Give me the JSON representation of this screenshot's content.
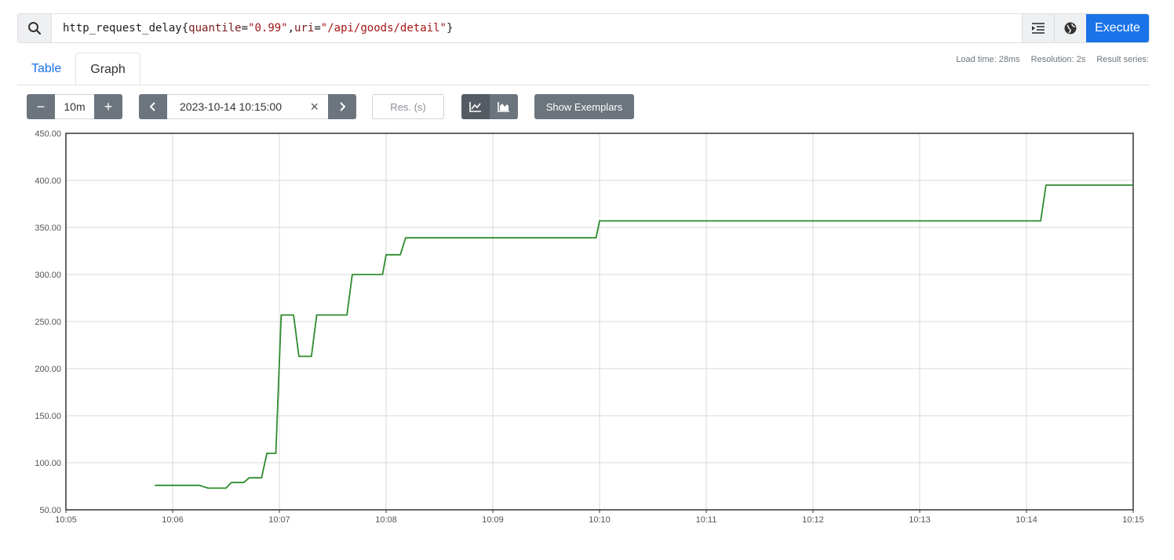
{
  "query": {
    "metric": "http_request_delay",
    "open_brace": "{",
    "label1_name": "quantile",
    "label1_value": "\"0.99\"",
    "label2_name": "uri",
    "label2_value": "\"/api/goods/detail\"",
    "close_brace": "}",
    "eq": "=",
    "comma": ","
  },
  "icons": {
    "search": "search-icon",
    "format": "format-query-icon",
    "explorer": "metrics-explorer-icon",
    "line": "line-chart-icon",
    "stacked": "stacked-chart-icon"
  },
  "execute_label": "Execute",
  "tabs": [
    {
      "label": "Table",
      "active": false
    },
    {
      "label": "Graph",
      "active": true
    }
  ],
  "stats": {
    "load_time": "Load time: 28ms",
    "resolution": "Resolution: 2s",
    "result_series": "Result series:"
  },
  "controls": {
    "minus": "−",
    "range": "10m",
    "plus": "+",
    "prev": "‹",
    "end_time": "2023-10-14 10:15:00",
    "clear": "×",
    "next": "›",
    "res_placeholder": "Res. (s)",
    "exemplars": "Show Exemplars"
  },
  "colors": {
    "series": "#2e8b2e",
    "accent": "#1a73e8",
    "button": "#6c757d"
  },
  "chart_data": {
    "type": "line",
    "x_ticks": [
      "10:05",
      "10:06",
      "10:07",
      "10:08",
      "10:09",
      "10:10",
      "10:11",
      "10:12",
      "10:13",
      "10:14",
      "10:15"
    ],
    "y_ticks": [
      "50.00",
      "100.00",
      "150.00",
      "200.00",
      "250.00",
      "300.00",
      "350.00",
      "400.00",
      "450.00"
    ],
    "xlim": [
      "10:05",
      "10:15"
    ],
    "ylim": [
      50,
      450
    ],
    "grid": true,
    "series": [
      {
        "points": [
          [
            "10:05:50",
            76
          ],
          [
            "10:06:15",
            76
          ],
          [
            "10:06:20",
            73
          ],
          [
            "10:06:30",
            73
          ],
          [
            "10:06:33",
            79
          ],
          [
            "10:06:40",
            79
          ],
          [
            "10:06:43",
            84
          ],
          [
            "10:06:50",
            84
          ],
          [
            "10:06:53",
            110
          ],
          [
            "10:06:58",
            110
          ],
          [
            "10:07:01",
            257
          ],
          [
            "10:07:08",
            257
          ],
          [
            "10:07:11",
            213
          ],
          [
            "10:07:18",
            213
          ],
          [
            "10:07:21",
            257
          ],
          [
            "10:07:38",
            257
          ],
          [
            "10:07:41",
            300
          ],
          [
            "10:07:58",
            300
          ],
          [
            "10:08:00",
            321
          ],
          [
            "10:08:08",
            321
          ],
          [
            "10:08:11",
            339
          ],
          [
            "10:09:58",
            339
          ],
          [
            "10:10:00",
            357
          ],
          [
            "10:14:08",
            357
          ],
          [
            "10:14:11",
            395
          ],
          [
            "10:15:00",
            395
          ]
        ]
      }
    ]
  }
}
